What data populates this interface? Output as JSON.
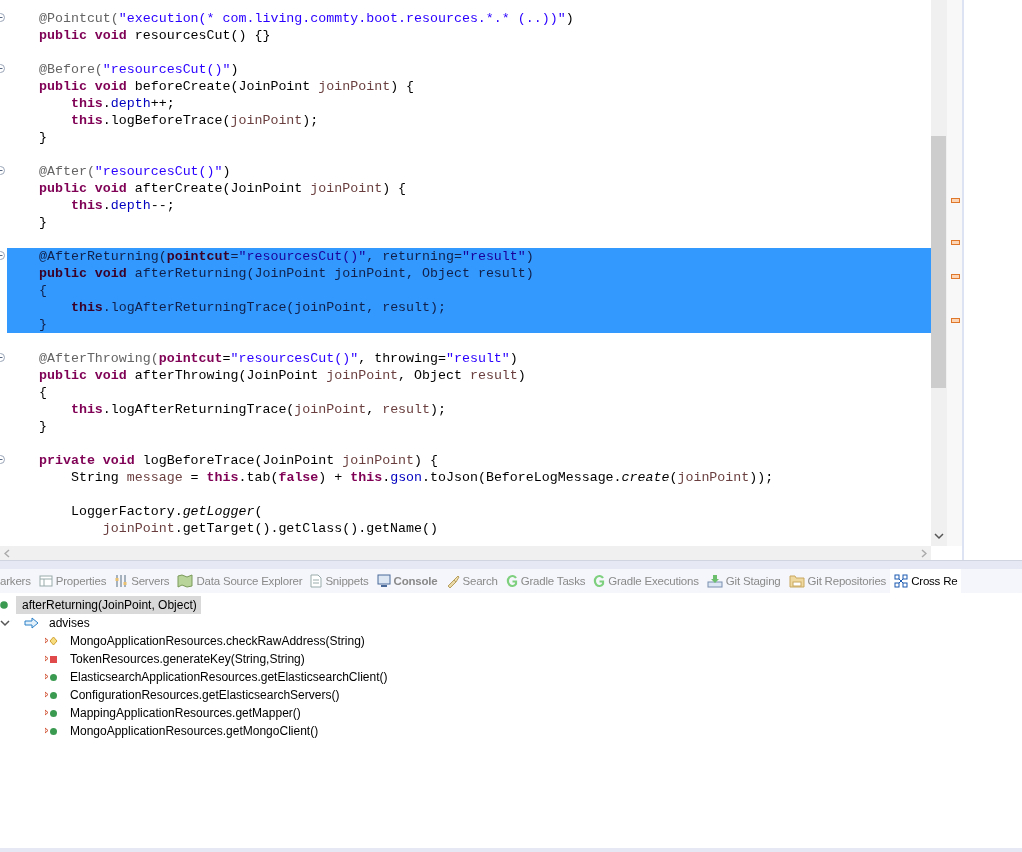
{
  "editor": {
    "lines": [
      {
        "selected": false,
        "fold": true,
        "tokens": [
          {
            "kind": "ann",
            "text": "@Pointcut("
          },
          {
            "kind": "str",
            "text": "\"execution(* com.living.commty.boot.resources.*.* (..))\""
          },
          {
            "kind": "plain",
            "text": ")"
          }
        ]
      },
      {
        "selected": false,
        "tokens": [
          {
            "kind": "kw",
            "text": "public void"
          },
          {
            "kind": "plain",
            "text": " resourcesCut() {}"
          }
        ]
      },
      {
        "selected": false
      },
      {
        "selected": false,
        "fold": true,
        "tokens": [
          {
            "kind": "ann",
            "text": "@Before("
          },
          {
            "kind": "str",
            "text": "\"resourcesCut()\""
          },
          {
            "kind": "plain",
            "text": ")"
          }
        ]
      },
      {
        "selected": false,
        "tokens": [
          {
            "kind": "kw",
            "text": "public void"
          },
          {
            "kind": "plain",
            "text": " beforeCreate(JoinPoint "
          },
          {
            "kind": "var",
            "text": "joinPoint"
          },
          {
            "kind": "plain",
            "text": ") {"
          }
        ]
      },
      {
        "selected": false,
        "tokens": [
          {
            "kind": "kw",
            "text": "    this"
          },
          {
            "kind": "plain",
            "text": "."
          },
          {
            "kind": "field",
            "text": "depth"
          },
          {
            "kind": "plain",
            "text": "++;"
          }
        ]
      },
      {
        "selected": false,
        "tokens": [
          {
            "kind": "kw",
            "text": "    this"
          },
          {
            "kind": "plain",
            "text": ".logBeforeTrace("
          },
          {
            "kind": "var",
            "text": "joinPoint"
          },
          {
            "kind": "plain",
            "text": ");"
          }
        ]
      },
      {
        "selected": false,
        "tokens": [
          {
            "kind": "plain",
            "text": "}"
          }
        ]
      },
      {
        "selected": false
      },
      {
        "selected": false,
        "fold": true,
        "tokens": [
          {
            "kind": "ann",
            "text": "@After("
          },
          {
            "kind": "str",
            "text": "\"resourcesCut()\""
          },
          {
            "kind": "plain",
            "text": ")"
          }
        ]
      },
      {
        "selected": false,
        "tokens": [
          {
            "kind": "kw",
            "text": "public void"
          },
          {
            "kind": "plain",
            "text": " afterCreate(JoinPoint "
          },
          {
            "kind": "var",
            "text": "joinPoint"
          },
          {
            "kind": "plain",
            "text": ") {"
          }
        ]
      },
      {
        "selected": false,
        "tokens": [
          {
            "kind": "kw",
            "text": "    this"
          },
          {
            "kind": "plain",
            "text": "."
          },
          {
            "kind": "field",
            "text": "depth"
          },
          {
            "kind": "plain",
            "text": "--;"
          }
        ]
      },
      {
        "selected": false,
        "tokens": [
          {
            "kind": "plain",
            "text": "}"
          }
        ]
      },
      {
        "selected": false
      },
      {
        "selected": true,
        "fold": true,
        "tokens": [
          {
            "kind": "ann",
            "text": "@AfterReturning("
          },
          {
            "kind": "kw",
            "text": "pointcut"
          },
          {
            "kind": "plain",
            "text": "="
          },
          {
            "kind": "str",
            "text": "\"resourcesCut()\""
          },
          {
            "kind": "plain",
            "text": ", returning="
          },
          {
            "kind": "str",
            "text": "\"result\""
          },
          {
            "kind": "plain",
            "text": ")"
          }
        ]
      },
      {
        "selected": true,
        "tokens": [
          {
            "kind": "kw",
            "text": "public void"
          },
          {
            "kind": "plain",
            "text": " afterReturning(JoinPoint "
          },
          {
            "kind": "var",
            "text": "joinPoint"
          },
          {
            "kind": "plain",
            "text": ", Object "
          },
          {
            "kind": "var",
            "text": "result"
          },
          {
            "kind": "plain",
            "text": ")"
          }
        ]
      },
      {
        "selected": true,
        "tokens": [
          {
            "kind": "plain",
            "text": "{"
          }
        ]
      },
      {
        "selected": true,
        "tokens": [
          {
            "kind": "kw",
            "text": "    this"
          },
          {
            "kind": "plain",
            "text": ".logAfterReturningTrace("
          },
          {
            "kind": "var",
            "text": "joinPoint"
          },
          {
            "kind": "plain",
            "text": ", "
          },
          {
            "kind": "var",
            "text": "result"
          },
          {
            "kind": "plain",
            "text": ");"
          }
        ]
      },
      {
        "selected": true,
        "tokens": [
          {
            "kind": "plain",
            "text": "}"
          }
        ]
      },
      {
        "selected": false
      },
      {
        "selected": false,
        "fold": true,
        "tokens": [
          {
            "kind": "ann",
            "text": "@AfterThrowing("
          },
          {
            "kind": "kw",
            "text": "pointcut"
          },
          {
            "kind": "plain",
            "text": "="
          },
          {
            "kind": "str",
            "text": "\"resourcesCut()\""
          },
          {
            "kind": "plain",
            "text": ", throwing="
          },
          {
            "kind": "str",
            "text": "\"result\""
          },
          {
            "kind": "plain",
            "text": ")"
          }
        ]
      },
      {
        "selected": false,
        "tokens": [
          {
            "kind": "kw",
            "text": "public void"
          },
          {
            "kind": "plain",
            "text": " afterThrowing(JoinPoint "
          },
          {
            "kind": "var",
            "text": "joinPoint"
          },
          {
            "kind": "plain",
            "text": ", Object "
          },
          {
            "kind": "var",
            "text": "result"
          },
          {
            "kind": "plain",
            "text": ")"
          }
        ]
      },
      {
        "selected": false,
        "tokens": [
          {
            "kind": "plain",
            "text": "{"
          }
        ]
      },
      {
        "selected": false,
        "tokens": [
          {
            "kind": "kw",
            "text": "    this"
          },
          {
            "kind": "plain",
            "text": ".logAfterReturningTrace("
          },
          {
            "kind": "var",
            "text": "joinPoint"
          },
          {
            "kind": "plain",
            "text": ", "
          },
          {
            "kind": "var",
            "text": "result"
          },
          {
            "kind": "plain",
            "text": ");"
          }
        ]
      },
      {
        "selected": false,
        "tokens": [
          {
            "kind": "plain",
            "text": "}"
          }
        ]
      },
      {
        "selected": false
      },
      {
        "selected": false,
        "fold": true,
        "tokens": [
          {
            "kind": "kw",
            "text": "private void"
          },
          {
            "kind": "plain",
            "text": " logBeforeTrace(JoinPoint "
          },
          {
            "kind": "var",
            "text": "joinPoint"
          },
          {
            "kind": "plain",
            "text": ") {"
          }
        ]
      },
      {
        "selected": false,
        "tokens": [
          {
            "kind": "plain",
            "text": "    String "
          },
          {
            "kind": "var",
            "text": "message"
          },
          {
            "kind": "plain",
            "text": " = "
          },
          {
            "kind": "kw",
            "text": "this"
          },
          {
            "kind": "plain",
            "text": ".tab("
          },
          {
            "kind": "kw",
            "text": "false"
          },
          {
            "kind": "plain",
            "text": ") + "
          },
          {
            "kind": "kw",
            "text": "this"
          },
          {
            "kind": "plain",
            "text": "."
          },
          {
            "kind": "field",
            "text": "gson"
          },
          {
            "kind": "plain",
            "text": ".toJson(BeforeLogMessage."
          },
          {
            "kind": "italic",
            "text": "create"
          },
          {
            "kind": "plain",
            "text": "("
          },
          {
            "kind": "var",
            "text": "joinPoint"
          },
          {
            "kind": "plain",
            "text": "));"
          }
        ]
      },
      {
        "selected": false
      },
      {
        "selected": false,
        "tokens": [
          {
            "kind": "plain",
            "text": "    LoggerFactory."
          },
          {
            "kind": "italic",
            "text": "getLogger"
          },
          {
            "kind": "plain",
            "text": "("
          }
        ]
      },
      {
        "selected": false,
        "tokens": [
          {
            "kind": "var",
            "text": "        joinPoint"
          },
          {
            "kind": "plain",
            "text": ".getTarget().getClass().getName()"
          }
        ]
      }
    ]
  },
  "tabs": [
    {
      "label": "arkers",
      "selected": false,
      "bold": false
    },
    {
      "label": "Properties",
      "selected": false,
      "bold": false
    },
    {
      "label": "Servers",
      "selected": false,
      "bold": false
    },
    {
      "label": "Data Source Explorer",
      "selected": false,
      "bold": false
    },
    {
      "label": "Snippets",
      "selected": false,
      "bold": false
    },
    {
      "label": "Console",
      "selected": false,
      "bold": true
    },
    {
      "label": "Search",
      "selected": false,
      "bold": false
    },
    {
      "label": "Gradle Tasks",
      "selected": false,
      "bold": false
    },
    {
      "label": "Gradle Executions",
      "selected": false,
      "bold": false
    },
    {
      "label": "Git Staging",
      "selected": false,
      "bold": false
    },
    {
      "label": "Git Repositories",
      "selected": false,
      "bold": false
    },
    {
      "label": "Cross Re",
      "selected": true,
      "bold": false
    }
  ],
  "tree": [
    {
      "label": "afterReturning(JoinPoint, Object)",
      "kind": "method",
      "selected": true,
      "children": [
        {
          "label": "advises",
          "kind": "relation",
          "selected": false,
          "expanded": true,
          "children": [
            {
              "label": "MongoApplicationResources.checkRawAddress(String)",
              "kind": "default",
              "selected": false
            },
            {
              "label": "TokenResources.generateKey(String,String)",
              "kind": "private",
              "selected": false
            },
            {
              "label": "ElasticsearchApplicationResources.getElasticsearchClient()",
              "kind": "public",
              "selected": false
            },
            {
              "label": "ConfigurationResources.getElasticsearchServers()",
              "kind": "public",
              "selected": false
            },
            {
              "label": "MappingApplicationResources.getMapper()",
              "kind": "public",
              "selected": false
            },
            {
              "label": "MongoApplicationResources.getMongoClient()",
              "kind": "public",
              "selected": false
            }
          ]
        }
      ]
    }
  ]
}
